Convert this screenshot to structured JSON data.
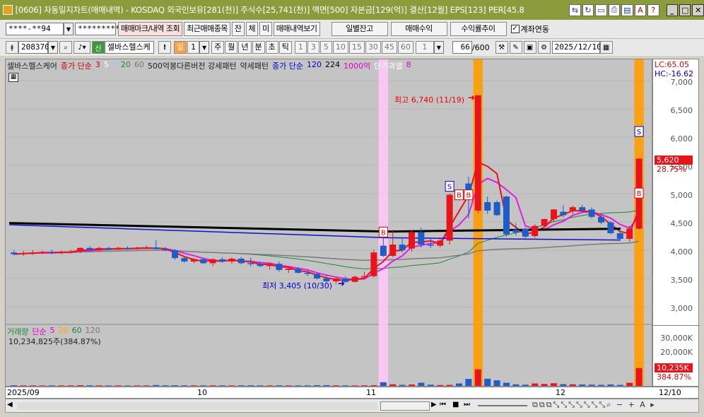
{
  "window": {
    "title": "[0606] 자동일지차트(매매내역) - KOSDAQ 외국인보유[281(천)] 주식수[25,741(천)] 액면[500] 자본금[129(억)] 결산[12월] EPS[123] PER[45.8"
  },
  "toolbar1": {
    "account": "****-**94",
    "password": "*********",
    "btn_mark": "매매마크/내역 조회",
    "btn_recent": "최근매매종목",
    "btn_jan": "잔",
    "btn_che": "체",
    "btn_mi": "미",
    "btn_view": "매매내역보기",
    "btn_daily": "일별잔고",
    "btn_profit": "매매수익",
    "btn_rate": "수익률추이",
    "chk_label": "계좌연동",
    "chk_mark": "✓"
  },
  "toolbar2": {
    "code": "208370",
    "sin": "신",
    "name": "셀바스헬스케",
    "period": "일",
    "period_num": "1",
    "periods": [
      "주",
      "월",
      "년",
      "분",
      "초",
      "틱"
    ],
    "nums": [
      "1",
      "3",
      "5",
      "10",
      "15",
      "30",
      "45",
      "60"
    ],
    "count_sel": "1",
    "count": "66",
    "total": "/600",
    "date": "2025/12/10"
  },
  "legend": {
    "name": "셀바스헬스케어",
    "ma_label": "종가 단순",
    "ma": [
      "3",
      "5",
      "7",
      "20",
      "60"
    ],
    "pattern": "500억봉다른버전 강세패턴",
    "weak": "약세패턴",
    "ma2_label": "종가 단순",
    "ma2": [
      "120",
      "224"
    ],
    "big": "1000억",
    "overheat": "단기과열",
    "overheat_n": "8"
  },
  "vol_legend": {
    "label": "거래량",
    "ma_label": "단순",
    "ma": [
      "5",
      "20",
      "60",
      "120"
    ],
    "value": "10,234,825주(384.87%)"
  },
  "annotations": {
    "high": "최고 6,740 (11/19)",
    "low": "최저 3,405 (10/30)",
    "b": "B",
    "s": "S"
  },
  "right_axis": {
    "lc": "LC:65.05",
    "hc": "HC:-16.62",
    "price_ticks": [
      "7,000",
      "6,500",
      "6,000",
      "5,500",
      "5,000",
      "4,500",
      "4,000",
      "3,500",
      "3,000"
    ],
    "last_price": "5,620",
    "last_pct": "28.75%",
    "vol_ticks": [
      "30,000K",
      "20,000K"
    ],
    "last_vol": "10,235K",
    "last_vol_pct": "384.87%"
  },
  "x_axis": [
    "2025/09",
    "10",
    "11",
    "12",
    "12/10"
  ],
  "colors": {
    "up": "#e8141c",
    "down": "#1e5cc8",
    "orange": "#ff9c00",
    "pink": "#ffc8f8"
  },
  "chart_data": {
    "type": "candlestick",
    "ylim": [
      2800,
      7200
    ],
    "candles": [
      {
        "o": 3960,
        "h": 4000,
        "l": 3910,
        "c": 3930
      },
      {
        "o": 3930,
        "h": 3990,
        "l": 3900,
        "c": 3950
      },
      {
        "o": 3950,
        "h": 4000,
        "l": 3920,
        "c": 3960
      },
      {
        "o": 3960,
        "h": 3990,
        "l": 3930,
        "c": 3970
      },
      {
        "o": 3970,
        "h": 4010,
        "l": 3930,
        "c": 3950
      },
      {
        "o": 3950,
        "h": 3990,
        "l": 3930,
        "c": 3970
      },
      {
        "o": 3970,
        "h": 4010,
        "l": 3940,
        "c": 3980
      },
      {
        "o": 3980,
        "h": 4050,
        "l": 3950,
        "c": 4040
      },
      {
        "o": 4040,
        "h": 4070,
        "l": 3980,
        "c": 4000
      },
      {
        "o": 4000,
        "h": 4060,
        "l": 3970,
        "c": 4040
      },
      {
        "o": 4040,
        "h": 4060,
        "l": 4000,
        "c": 4010
      },
      {
        "o": 4010,
        "h": 4060,
        "l": 4000,
        "c": 4040
      },
      {
        "o": 4040,
        "h": 4070,
        "l": 4010,
        "c": 4030
      },
      {
        "o": 4030,
        "h": 4060,
        "l": 4010,
        "c": 4040
      },
      {
        "o": 4040,
        "h": 4080,
        "l": 4020,
        "c": 4050
      },
      {
        "o": 4050,
        "h": 4180,
        "l": 4010,
        "c": 4020
      },
      {
        "o": 4020,
        "h": 4060,
        "l": 3980,
        "c": 4000
      },
      {
        "o": 4000,
        "h": 4020,
        "l": 3830,
        "c": 3860
      },
      {
        "o": 3860,
        "h": 3900,
        "l": 3780,
        "c": 3800
      },
      {
        "o": 3800,
        "h": 3860,
        "l": 3770,
        "c": 3840
      },
      {
        "o": 3840,
        "h": 3870,
        "l": 3750,
        "c": 3770
      },
      {
        "o": 3770,
        "h": 3860,
        "l": 3720,
        "c": 3840
      },
      {
        "o": 3840,
        "h": 3880,
        "l": 3780,
        "c": 3800
      },
      {
        "o": 3800,
        "h": 3870,
        "l": 3760,
        "c": 3850
      },
      {
        "o": 3850,
        "h": 3880,
        "l": 3750,
        "c": 3770
      },
      {
        "o": 3770,
        "h": 3870,
        "l": 3710,
        "c": 3760
      },
      {
        "o": 3760,
        "h": 3800,
        "l": 3700,
        "c": 3720
      },
      {
        "o": 3720,
        "h": 3780,
        "l": 3660,
        "c": 3760
      },
      {
        "o": 3760,
        "h": 3800,
        "l": 3620,
        "c": 3650
      },
      {
        "o": 3650,
        "h": 3690,
        "l": 3600,
        "c": 3670
      },
      {
        "o": 3670,
        "h": 3700,
        "l": 3580,
        "c": 3600
      },
      {
        "o": 3600,
        "h": 3640,
        "l": 3540,
        "c": 3580
      },
      {
        "o": 3580,
        "h": 3600,
        "l": 3480,
        "c": 3500
      },
      {
        "o": 3500,
        "h": 3560,
        "l": 3430,
        "c": 3450
      },
      {
        "o": 3450,
        "h": 3520,
        "l": 3405,
        "c": 3500
      },
      {
        "o": 3500,
        "h": 3540,
        "l": 3420,
        "c": 3440
      },
      {
        "o": 3440,
        "h": 3550,
        "l": 3430,
        "c": 3530
      },
      {
        "o": 3530,
        "h": 3620,
        "l": 3500,
        "c": 3540
      },
      {
        "o": 3540,
        "h": 4010,
        "l": 3520,
        "c": 3960
      },
      {
        "o": 4080,
        "h": 4300,
        "l": 3880,
        "c": 3900
      },
      {
        "o": 3900,
        "h": 4360,
        "l": 3880,
        "c": 4100
      },
      {
        "o": 4100,
        "h": 4200,
        "l": 3960,
        "c": 4000
      },
      {
        "o": 4030,
        "h": 4350,
        "l": 3970,
        "c": 4320
      },
      {
        "o": 4320,
        "h": 4400,
        "l": 4050,
        "c": 4100
      },
      {
        "o": 4100,
        "h": 4210,
        "l": 4040,
        "c": 4080
      },
      {
        "o": 4080,
        "h": 4200,
        "l": 4050,
        "c": 4170
      },
      {
        "o": 4170,
        "h": 5000,
        "l": 4100,
        "c": 4980
      },
      {
        "o": 4980,
        "h": 5060,
        "l": 4880,
        "c": 4920
      },
      {
        "o": 5180,
        "h": 5300,
        "l": 4560,
        "c": 5010
      },
      {
        "o": 4700,
        "h": 6740,
        "l": 4650,
        "c": 6740
      },
      {
        "o": 4850,
        "h": 4950,
        "l": 4640,
        "c": 4700
      },
      {
        "o": 4850,
        "h": 4880,
        "l": 4600,
        "c": 4620
      },
      {
        "o": 4950,
        "h": 4960,
        "l": 4240,
        "c": 4280
      },
      {
        "o": 4360,
        "h": 4480,
        "l": 4260,
        "c": 4310
      },
      {
        "o": 4380,
        "h": 4400,
        "l": 4210,
        "c": 4240
      },
      {
        "o": 4250,
        "h": 4460,
        "l": 4220,
        "c": 4430
      },
      {
        "o": 4430,
        "h": 4560,
        "l": 4400,
        "c": 4550
      },
      {
        "o": 4550,
        "h": 4730,
        "l": 4510,
        "c": 4720
      },
      {
        "o": 4680,
        "h": 4800,
        "l": 4580,
        "c": 4620
      },
      {
        "o": 4700,
        "h": 4790,
        "l": 4640,
        "c": 4760
      },
      {
        "o": 4760,
        "h": 4800,
        "l": 4680,
        "c": 4700
      },
      {
        "o": 4720,
        "h": 4760,
        "l": 4560,
        "c": 4590
      },
      {
        "o": 4590,
        "h": 4640,
        "l": 4460,
        "c": 4490
      },
      {
        "o": 4490,
        "h": 4520,
        "l": 4280,
        "c": 4300
      },
      {
        "o": 4300,
        "h": 4350,
        "l": 4180,
        "c": 4200
      },
      {
        "o": 4200,
        "h": 4430,
        "l": 4150,
        "c": 4380
      },
      {
        "o": 4380,
        "h": 5620,
        "l": 4370,
        "c": 5620
      }
    ],
    "volume_k": [
      400,
      300,
      300,
      250,
      300,
      280,
      300,
      400,
      350,
      300,
      280,
      300,
      250,
      280,
      300,
      500,
      350,
      400,
      350,
      300,
      300,
      320,
      300,
      280,
      300,
      350,
      300,
      280,
      350,
      300,
      280,
      300,
      400,
      450,
      350,
      300,
      300,
      350,
      400,
      2100,
      900,
      600,
      800,
      1800,
      700,
      500,
      600,
      1400,
      4000,
      9500,
      4100,
      3200,
      1800,
      900,
      700,
      1400,
      1100,
      1500,
      1000,
      900,
      800,
      700,
      600,
      800,
      600,
      1800,
      10235
    ]
  }
}
